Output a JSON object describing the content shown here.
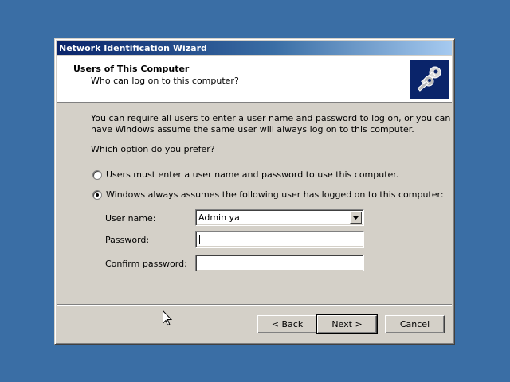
{
  "window": {
    "title": "Network Identification Wizard"
  },
  "header": {
    "title": "Users of This Computer",
    "subtitle": "Who can log on to this computer?",
    "icon": "keys-icon"
  },
  "body": {
    "intro_line1": "You can require all users to enter a user name and password to log on, or you can",
    "intro_line2": "have Windows assume the same user will always log on to this computer.",
    "question": "Which option do you prefer?"
  },
  "options": {
    "require_login": {
      "label": "Users must enter a user name and password to use this computer.",
      "selected": false
    },
    "auto_login": {
      "label": "Windows always assumes the following user has logged on to this computer:",
      "selected": true
    }
  },
  "fields": {
    "user_name": {
      "label": "User name:",
      "value": "Admin ya"
    },
    "password": {
      "label": "Password:",
      "value": ""
    },
    "confirm_password": {
      "label": "Confirm password:",
      "value": ""
    }
  },
  "buttons": {
    "back": "< Back",
    "next": "Next >",
    "cancel": "Cancel"
  },
  "colors": {
    "desktop": "#3a6ea5",
    "titlebar": "#0a246a",
    "dialog_face": "#d4d0c8"
  }
}
